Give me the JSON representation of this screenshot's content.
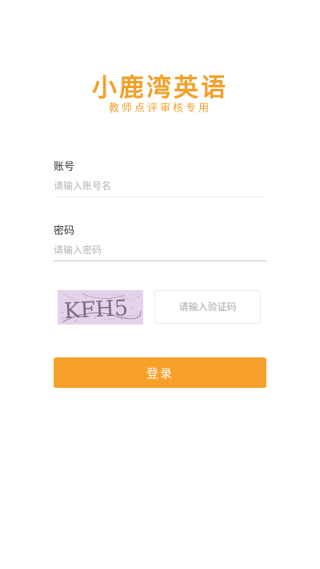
{
  "brand": {
    "logo_text": "小鹿湾英语",
    "subtitle": "教师点评审核专用",
    "accent_color": "#f2a02a"
  },
  "form": {
    "account": {
      "label": "账号",
      "value": "",
      "placeholder": "请输入账号名"
    },
    "password": {
      "label": "密码",
      "value": "",
      "placeholder": "请输入密码"
    },
    "captcha": {
      "image_text": "KFH5",
      "value": "",
      "placeholder": "请输入验证码"
    },
    "submit_label": "登录",
    "submit_color": "#f7a02a"
  }
}
